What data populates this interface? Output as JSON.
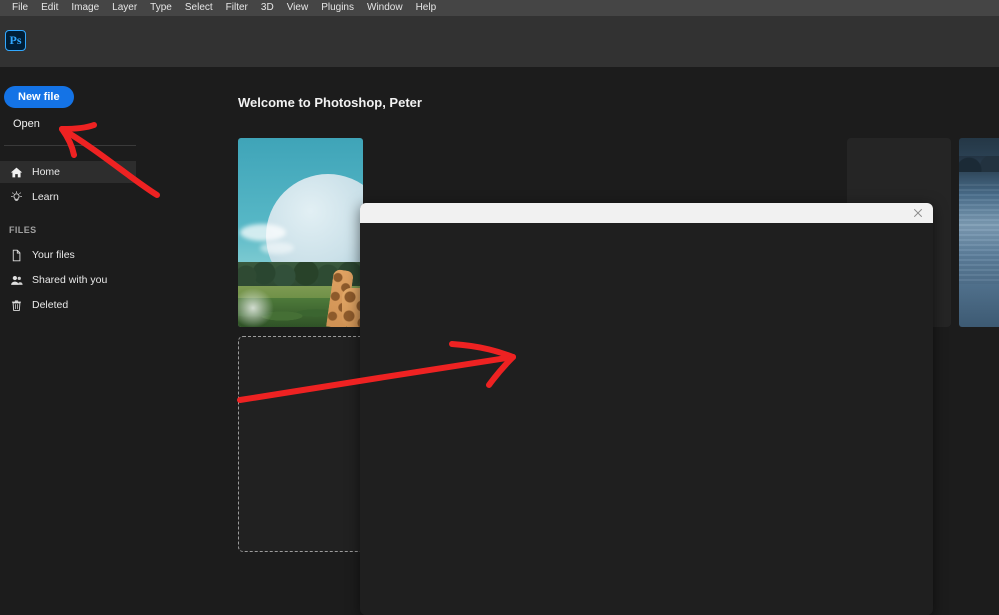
{
  "menubar": {
    "items": [
      {
        "label": "File"
      },
      {
        "label": "Edit"
      },
      {
        "label": "Image"
      },
      {
        "label": "Layer"
      },
      {
        "label": "Type"
      },
      {
        "label": "Select"
      },
      {
        "label": "Filter"
      },
      {
        "label": "3D"
      },
      {
        "label": "View"
      },
      {
        "label": "Plugins"
      },
      {
        "label": "Window"
      },
      {
        "label": "Help"
      }
    ]
  },
  "app": {
    "logo_text": "Ps",
    "logo_icon": "photoshop-logo-icon",
    "accent_color": "#31a8ff",
    "button_color": "#1473e6",
    "annotation_color": "#ee2222"
  },
  "sidebar": {
    "new_file_label": "New file",
    "open_label": "Open",
    "nav": [
      {
        "label": "Home",
        "icon": "home-icon",
        "active": true
      },
      {
        "label": "Learn",
        "icon": "lightbulb-icon",
        "active": false
      }
    ],
    "files_section_title": "FILES",
    "files": [
      {
        "label": "Your files",
        "icon": "document-icon"
      },
      {
        "label": "Shared with you",
        "icon": "people-icon"
      },
      {
        "label": "Deleted",
        "icon": "trash-icon"
      }
    ]
  },
  "main": {
    "welcome_title": "Welcome to Photoshop, Peter",
    "recent_cards": [
      {
        "name": "giraffe-moon-artwork-thumbnail"
      },
      {
        "name": "empty-card"
      },
      {
        "name": "lake-photo-thumbnail"
      }
    ],
    "drop_card": {
      "name": "drop-zone-card"
    }
  },
  "dialog": {
    "close_icon": "close-icon",
    "title": "",
    "body_text": ""
  },
  "annotations": [
    {
      "name": "arrow-pointing-to-open",
      "target": "Open"
    },
    {
      "name": "arrow-pointing-to-dialog",
      "target": "dialog"
    }
  ]
}
